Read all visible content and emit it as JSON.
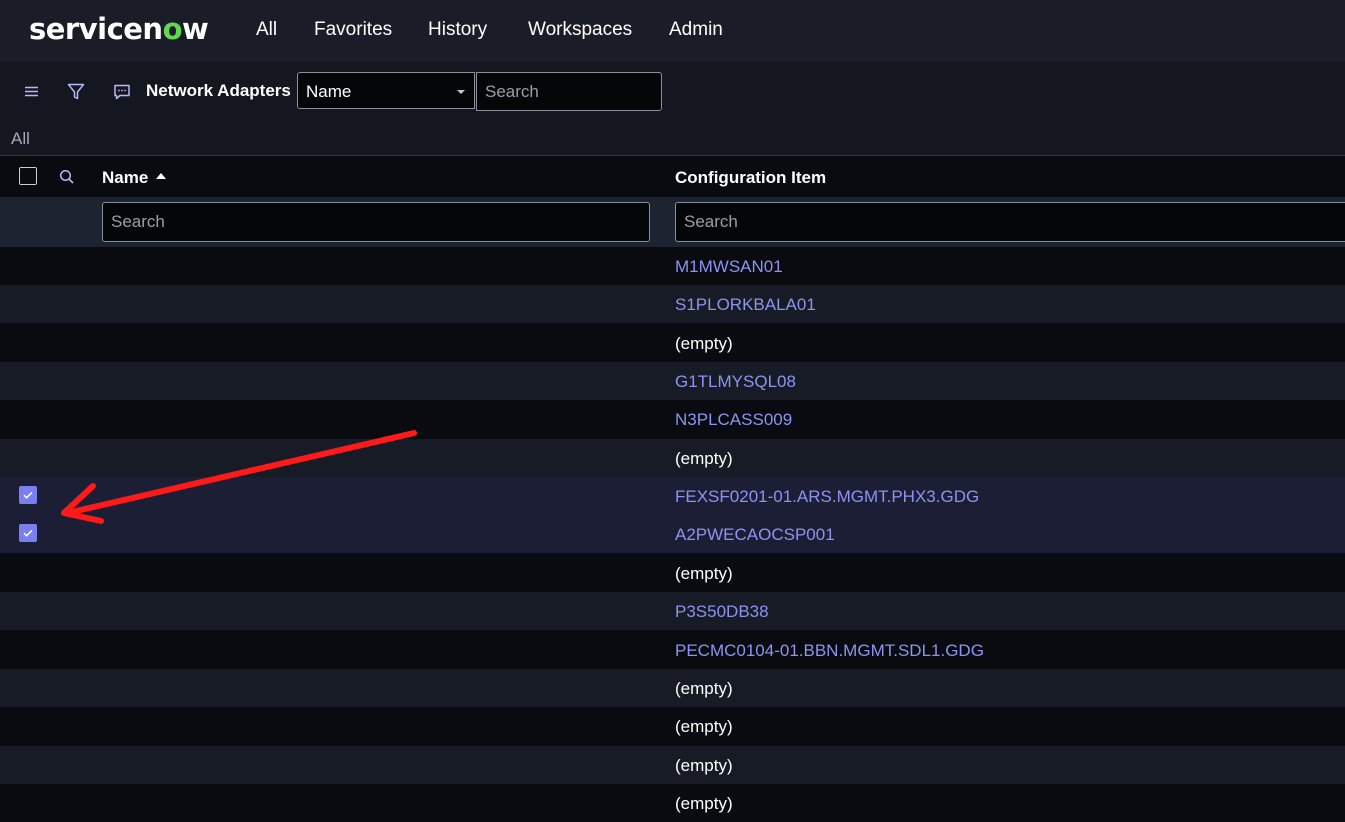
{
  "nav": {
    "logo_pre": "servicen",
    "logo_o": "o",
    "logo_post": "w",
    "items": [
      "All",
      "Favorites",
      "History",
      "Workspaces",
      "Admin"
    ]
  },
  "toolbar": {
    "list_title": "Network Adapters",
    "field_select_value": "Name",
    "search_placeholder": "Search",
    "icons": [
      "hamburger-menu-icon",
      "filter-icon",
      "comment-icon"
    ]
  },
  "breadcrumb": "All",
  "table": {
    "columns": [
      "Name",
      "Configuration Item"
    ],
    "sort": "ascending",
    "column_search_placeholder": "Search",
    "rows": [
      {
        "name": "",
        "ci": "M1MWSAN01",
        "link": true,
        "selected": false
      },
      {
        "name": "",
        "ci": "S1PLORKBALA01",
        "link": true,
        "selected": false
      },
      {
        "name": "",
        "ci": "(empty)",
        "link": false,
        "selected": false
      },
      {
        "name": "",
        "ci": "G1TLMYSQL08",
        "link": true,
        "selected": false
      },
      {
        "name": "",
        "ci": "N3PLCASS009",
        "link": true,
        "selected": false
      },
      {
        "name": "",
        "ci": "(empty)",
        "link": false,
        "selected": false
      },
      {
        "name": "",
        "ci": "FEXSF0201-01.ARS.MGMT.PHX3.GDG",
        "link": true,
        "selected": true
      },
      {
        "name": "",
        "ci": "A2PWECAOCSP001",
        "link": true,
        "selected": true
      },
      {
        "name": "",
        "ci": "(empty)",
        "link": false,
        "selected": false
      },
      {
        "name": "",
        "ci": "P3S50DB38",
        "link": true,
        "selected": false
      },
      {
        "name": "",
        "ci": "PECMC0104-01.BBN.MGMT.SDL1.GDG",
        "link": true,
        "selected": false
      },
      {
        "name": "",
        "ci": "(empty)",
        "link": false,
        "selected": false
      },
      {
        "name": "",
        "ci": "(empty)",
        "link": false,
        "selected": false
      },
      {
        "name": "",
        "ci": "(empty)",
        "link": false,
        "selected": false
      },
      {
        "name": "",
        "ci": "(empty)",
        "link": false,
        "selected": false
      }
    ]
  },
  "colors": {
    "row_even": "#090b10",
    "row_odd": "#171b25",
    "row_selected": "#1c1e36",
    "link": "#8d93f0",
    "annotation_arrow": "#ff1a1a"
  }
}
